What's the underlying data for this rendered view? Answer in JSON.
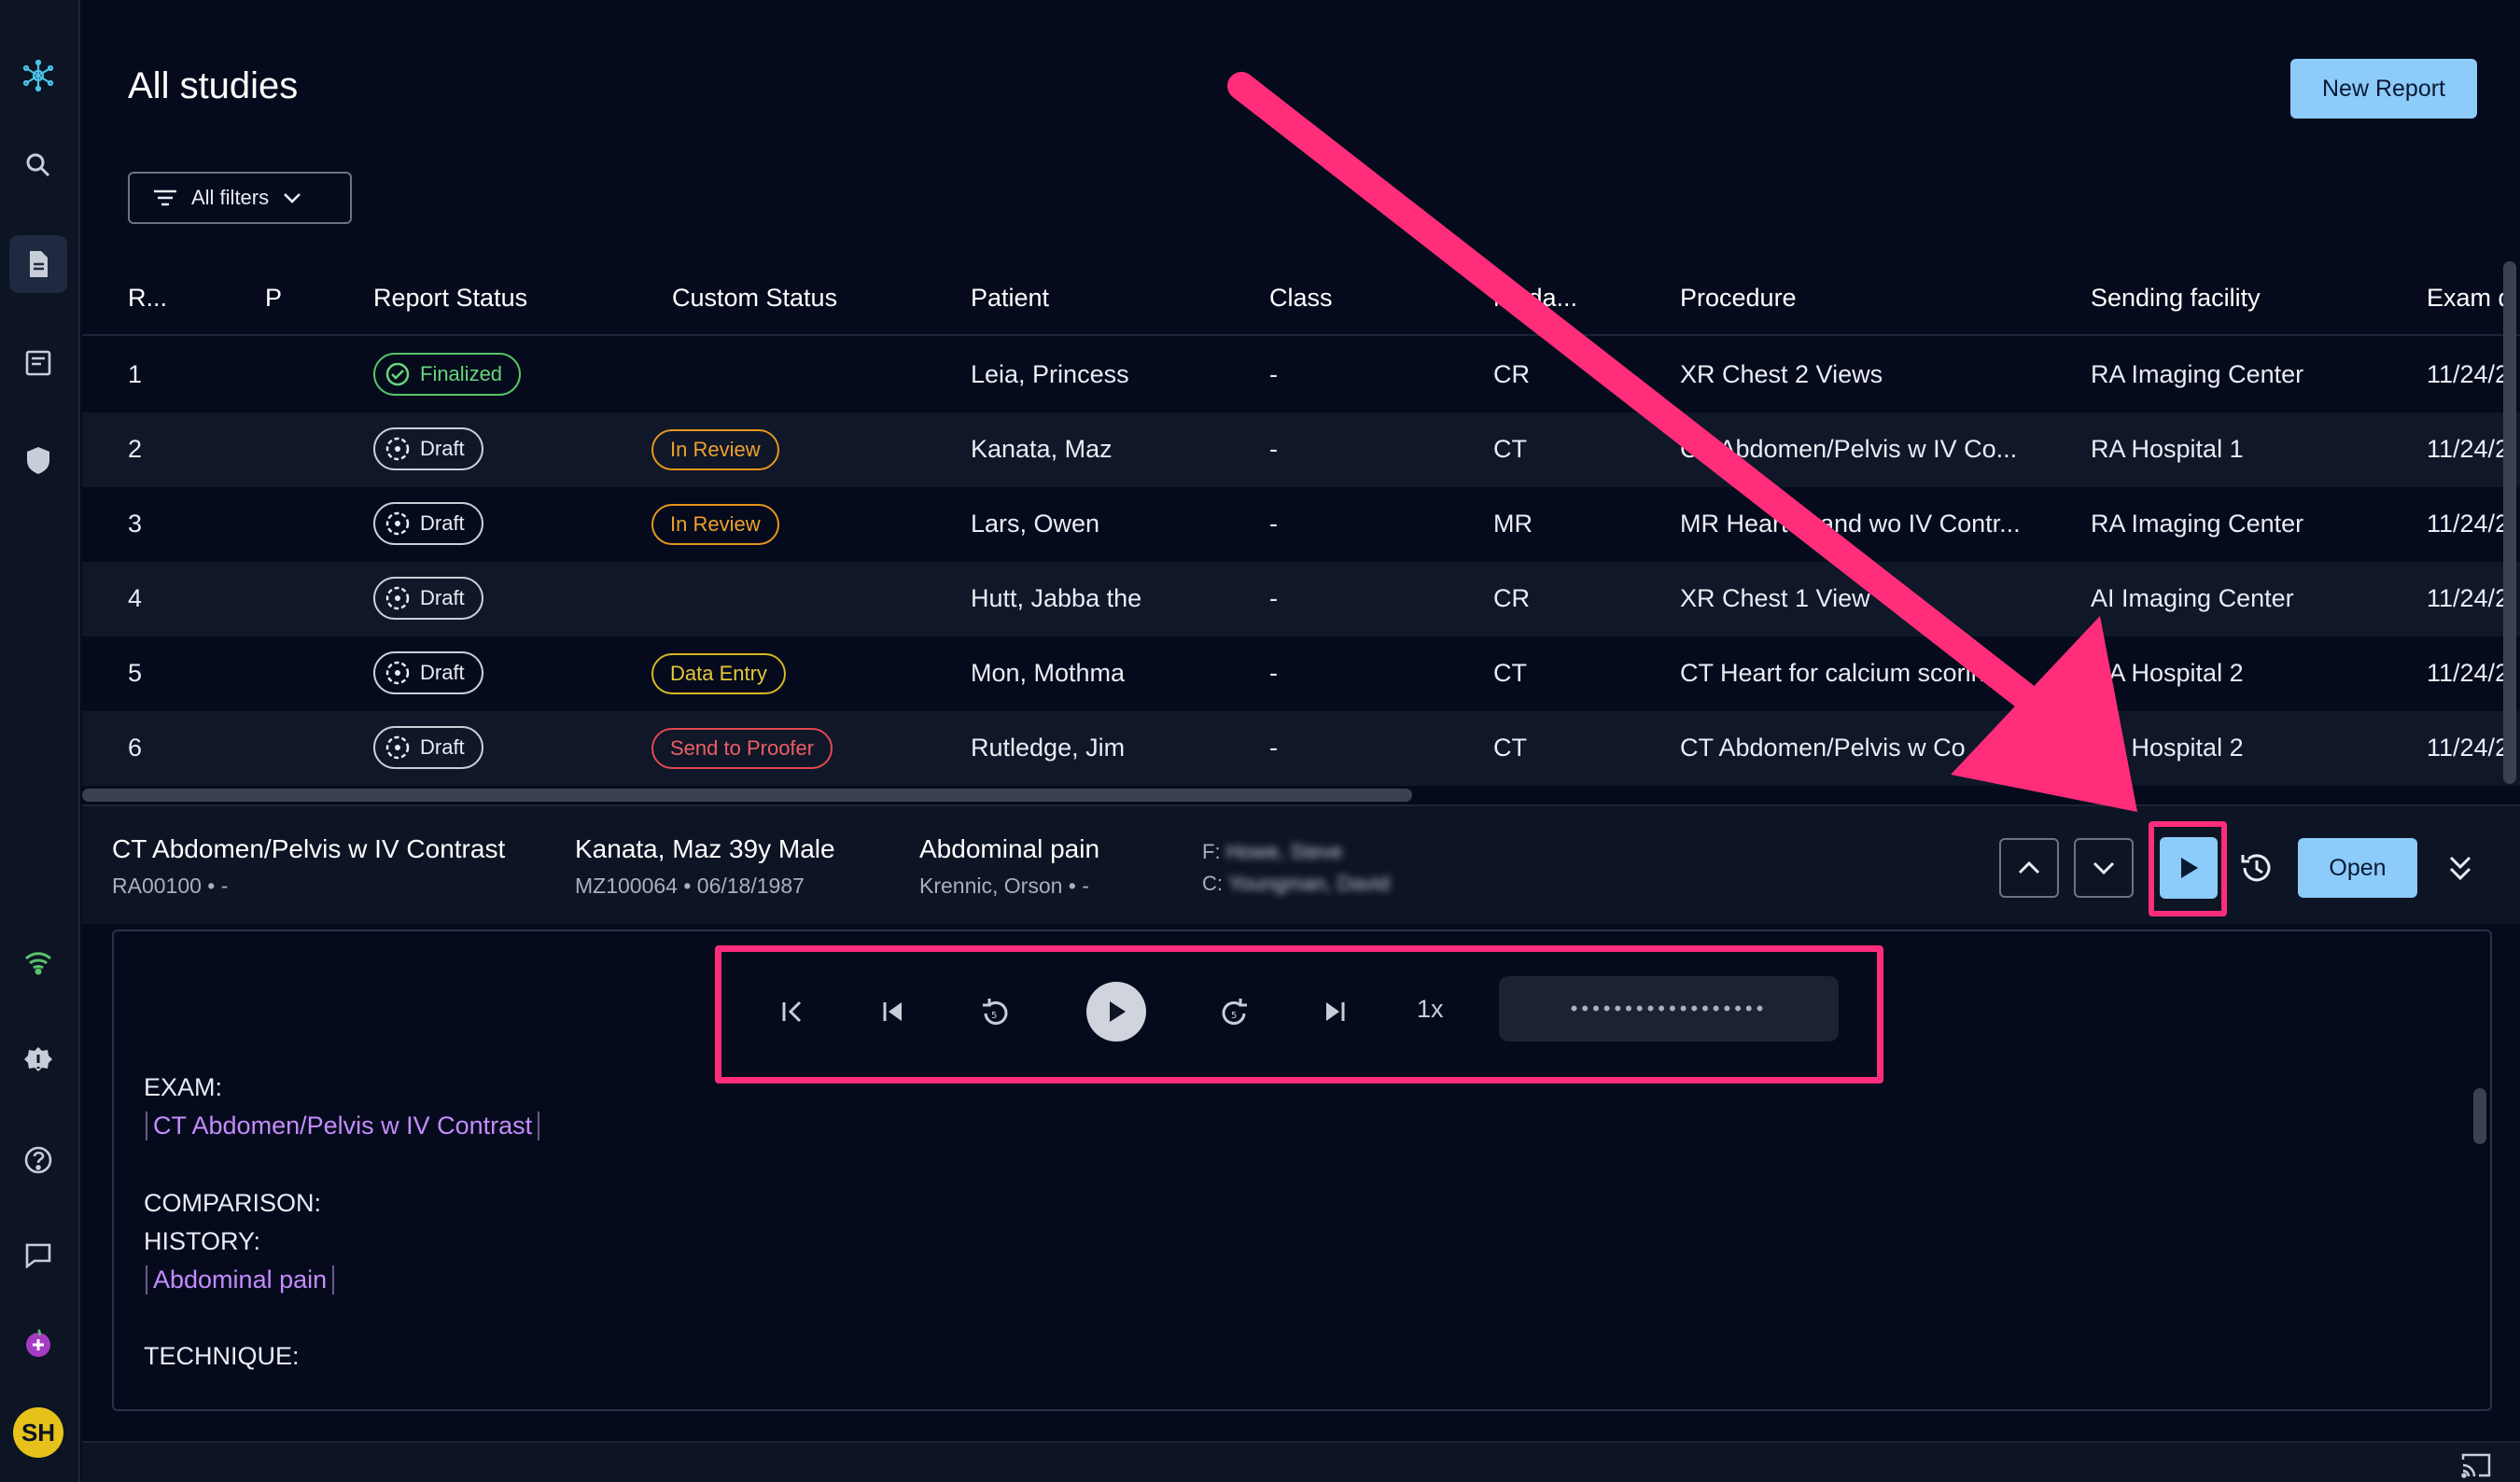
{
  "header": {
    "title": "All studies",
    "new_report_label": "New Report",
    "filters_label": "All filters"
  },
  "table": {
    "columns": [
      "R...",
      "P",
      "Report Status",
      "Custom Status",
      "Patient",
      "Class",
      "Moda...",
      "Procedure",
      "Sending facility",
      "Exam d"
    ],
    "rows": [
      {
        "r": "1",
        "status": "Finalized",
        "custom": "",
        "patient": "Leia, Princess",
        "class": "-",
        "modality": "CR",
        "procedure": "XR Chest 2 Views",
        "facility": "RA Imaging Center",
        "exam": "11/24/2"
      },
      {
        "r": "2",
        "status": "Draft",
        "custom": "In Review",
        "patient": "Kanata, Maz",
        "class": "-",
        "modality": "CT",
        "procedure": "CT Abdomen/Pelvis w IV Co...",
        "facility": "RA Hospital 1",
        "exam": "11/24/2"
      },
      {
        "r": "3",
        "status": "Draft",
        "custom": "In Review",
        "patient": "Lars, Owen",
        "class": "-",
        "modality": "MR",
        "procedure": "MR Heart w and wo IV Contr...",
        "facility": "RA Imaging Center",
        "exam": "11/24/2"
      },
      {
        "r": "4",
        "status": "Draft",
        "custom": "",
        "patient": "Hutt, Jabba the",
        "class": "-",
        "modality": "CR",
        "procedure": "XR Chest 1 View",
        "facility": "AI Imaging Center",
        "exam": "11/24/2"
      },
      {
        "r": "5",
        "status": "Draft",
        "custom": "Data Entry",
        "patient": "Mon, Mothma",
        "class": "-",
        "modality": "CT",
        "procedure": "CT Heart for calcium scoring",
        "facility": "RA Hospital 2",
        "exam": "11/24/2"
      },
      {
        "r": "6",
        "status": "Draft",
        "custom": "Send to Proofer",
        "patient": "Rutledge, Jim",
        "class": "-",
        "modality": "CT",
        "procedure": "CT Abdomen/Pelvis w Co",
        "facility": "RA Hospital 2",
        "exam": "11/24/2"
      }
    ]
  },
  "detail": {
    "procedure": "CT Abdomen/Pelvis w IV Contrast",
    "accession": "RA00100 • -",
    "patient": "Kanata, Maz 39y Male",
    "mrn": "MZ100064 • 06/18/1987",
    "indication": "Abdominal pain",
    "referring": "Krennic, Orson • -",
    "f_label": "F:",
    "f_value": "Howe, Steve",
    "c_label": "C:",
    "c_value": "Youngman, David",
    "open_label": "Open"
  },
  "player": {
    "speed": "1x",
    "waveform": "••••••••••••••••••"
  },
  "report": {
    "exam_label": "EXAM:",
    "exam_value": "CT Abdomen/Pelvis w IV Contrast",
    "comparison_label": "COMPARISON:",
    "history_label": "HISTORY:",
    "history_value": "Abdominal pain",
    "technique_label": "TECHNIQUE:"
  },
  "user": {
    "initials": "SH"
  },
  "colors": {
    "accent": "#8ccbfa",
    "highlight": "#ff2d7a",
    "background": "#050b1c"
  }
}
